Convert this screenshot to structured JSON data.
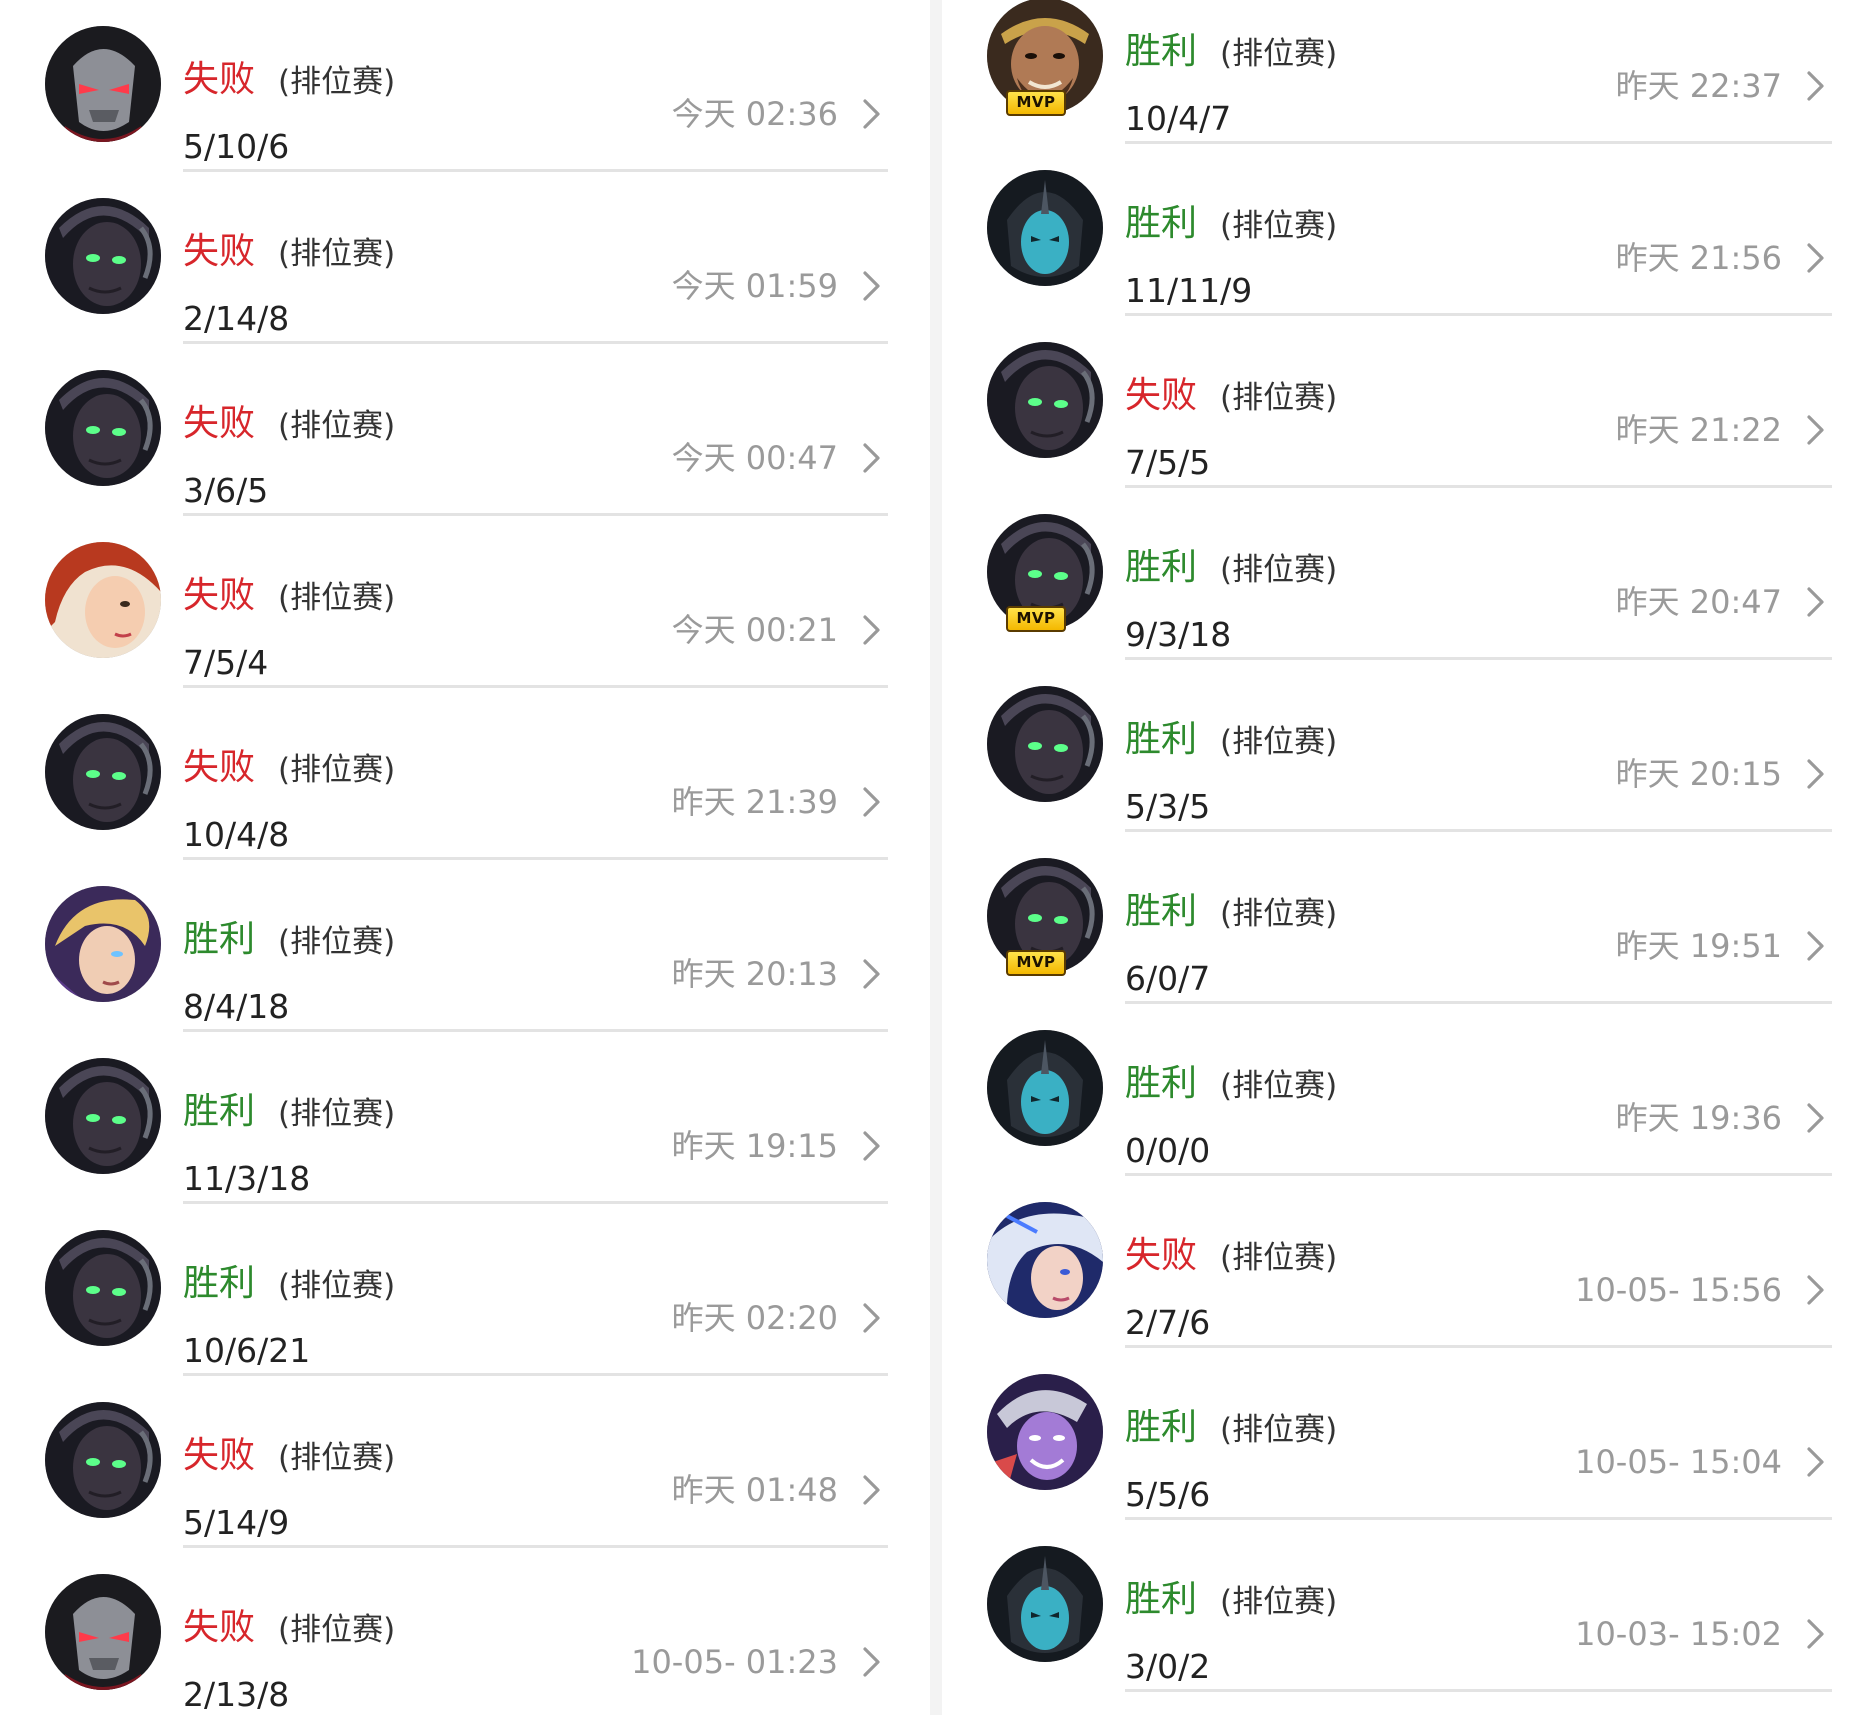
{
  "mvp_label": "MVP",
  "mode_label": "(排位赛)",
  "colors": {
    "loss": "#d7262b",
    "win": "#2d8a2d"
  },
  "left_column": [
    {
      "result": "失败",
      "outcome": "loss",
      "kda": "5/10/6",
      "time": "今天 02:36",
      "avatar_icon": "masked-assassin-icon",
      "mvp": false
    },
    {
      "result": "失败",
      "outcome": "loss",
      "kda": "2/14/8",
      "time": "今天 01:59",
      "avatar_icon": "dark-mage-icon",
      "mvp": false
    },
    {
      "result": "失败",
      "outcome": "loss",
      "kda": "3/6/5",
      "time": "今天 00:47",
      "avatar_icon": "dark-mage-icon",
      "mvp": false
    },
    {
      "result": "失败",
      "outcome": "loss",
      "kda": "7/5/4",
      "time": "今天 00:21",
      "avatar_icon": "red-hair-gunner-icon",
      "mvp": false
    },
    {
      "result": "失败",
      "outcome": "loss",
      "kda": "10/4/8",
      "time": "昨天 21:39",
      "avatar_icon": "dark-mage-icon",
      "mvp": false
    },
    {
      "result": "胜利",
      "outcome": "win",
      "kda": "8/4/18",
      "time": "昨天 20:13",
      "avatar_icon": "blond-mage-icon",
      "mvp": false
    },
    {
      "result": "胜利",
      "outcome": "win",
      "kda": "11/3/18",
      "time": "昨天 19:15",
      "avatar_icon": "dark-mage-icon",
      "mvp": false
    },
    {
      "result": "胜利",
      "outcome": "win",
      "kda": "10/6/21",
      "time": "昨天 02:20",
      "avatar_icon": "dark-mage-icon",
      "mvp": false
    },
    {
      "result": "失败",
      "outcome": "loss",
      "kda": "5/14/9",
      "time": "昨天 01:48",
      "avatar_icon": "dark-mage-icon",
      "mvp": false
    },
    {
      "result": "失败",
      "outcome": "loss",
      "kda": "2/13/8",
      "time": "10-05- 01:23",
      "avatar_icon": "masked-assassin-icon",
      "mvp": false
    }
  ],
  "right_column": [
    {
      "result": "胜利",
      "outcome": "win",
      "kda": "10/4/7",
      "time": "昨天 22:37",
      "avatar_icon": "bearded-warrior-icon",
      "mvp": true
    },
    {
      "result": "胜利",
      "outcome": "win",
      "kda": "11/11/9",
      "time": "昨天 21:56",
      "avatar_icon": "blue-helmet-icon",
      "mvp": false
    },
    {
      "result": "失败",
      "outcome": "loss",
      "kda": "7/5/5",
      "time": "昨天 21:22",
      "avatar_icon": "dark-mage-icon",
      "mvp": false
    },
    {
      "result": "胜利",
      "outcome": "win",
      "kda": "9/3/18",
      "time": "昨天 20:47",
      "avatar_icon": "dark-mage-icon",
      "mvp": true
    },
    {
      "result": "胜利",
      "outcome": "win",
      "kda": "5/3/5",
      "time": "昨天 20:15",
      "avatar_icon": "dark-mage-icon",
      "mvp": false
    },
    {
      "result": "胜利",
      "outcome": "win",
      "kda": "6/0/7",
      "time": "昨天 19:51",
      "avatar_icon": "dark-mage-icon",
      "mvp": true
    },
    {
      "result": "胜利",
      "outcome": "win",
      "kda": "0/0/0",
      "time": "昨天 19:36",
      "avatar_icon": "blue-helmet-icon",
      "mvp": false
    },
    {
      "result": "失败",
      "outcome": "loss",
      "kda": "2/7/6",
      "time": "10-05- 15:56",
      "avatar_icon": "silver-hair-archer-icon",
      "mvp": false
    },
    {
      "result": "胜利",
      "outcome": "win",
      "kda": "5/5/6",
      "time": "10-05- 15:04",
      "avatar_icon": "purple-ninja-icon",
      "mvp": false
    },
    {
      "result": "胜利",
      "outcome": "win",
      "kda": "3/0/2",
      "time": "10-03- 15:02",
      "avatar_icon": "blue-helmet-icon",
      "mvp": false
    }
  ]
}
